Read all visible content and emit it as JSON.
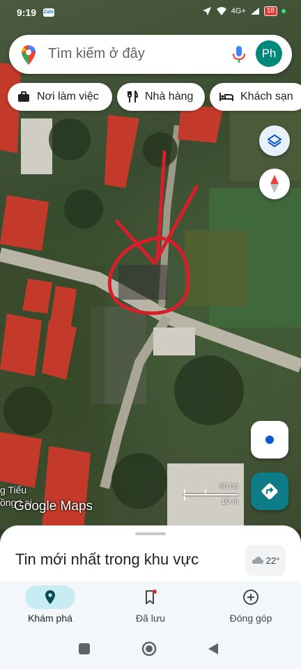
{
  "status_bar": {
    "time": "9:19",
    "zalo_label": "Zalo",
    "network": "4G+",
    "battery": "18"
  },
  "search": {
    "placeholder": "Tìm kiếm ở đây",
    "avatar_initials": "Ph"
  },
  "chips": [
    {
      "label": "Nơi làm việc",
      "icon": "briefcase-icon"
    },
    {
      "label": "Nhà hàng",
      "icon": "restaurant-icon"
    },
    {
      "label": "Khách sạn",
      "icon": "hotel-icon"
    }
  ],
  "map": {
    "place_label_line1": "g Tiểu",
    "place_label_line2": "ồng Lai",
    "logo": "Google Maps",
    "scale_top": "50 bộ",
    "scale_bottom": "10 m",
    "annotation_color": "#d81e2a"
  },
  "sheet": {
    "title": "Tin mới nhất trong khu vực",
    "weather": "22°"
  },
  "bottom_nav": [
    {
      "label": "Khám phá",
      "icon": "location-pin-icon",
      "active": true
    },
    {
      "label": "Đã lưu",
      "icon": "bookmark-icon",
      "active": false
    },
    {
      "label": "Đóng góp",
      "icon": "add-circle-icon",
      "active": false
    }
  ],
  "colors": {
    "accent": "#0e7c86",
    "active_pill": "#c7ecf1",
    "avatar": "#00897b"
  }
}
